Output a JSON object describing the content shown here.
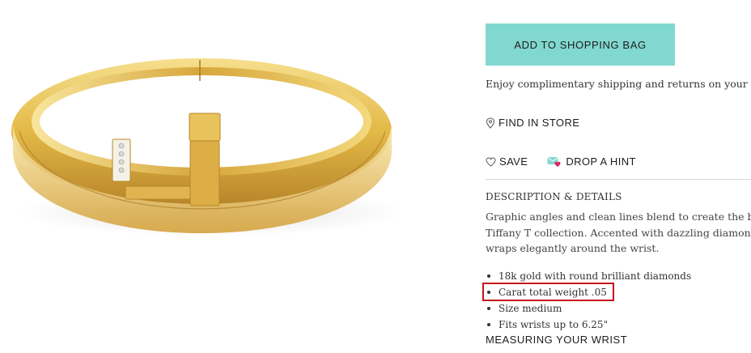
{
  "product": {
    "image_name": "tiffany-t-square-bracelet"
  },
  "purchase": {
    "add_to_bag_label": "ADD TO SHOPPING BAG",
    "shipping_text": "Enjoy complimentary shipping and returns on your orde",
    "accent_color": "#81d8d0"
  },
  "actions": {
    "find_in_store": "FIND IN STORE",
    "save": "SAVE",
    "drop_hint": "DROP A HINT"
  },
  "description": {
    "heading": "DESCRIPTION & DETAILS",
    "lines": [
      "Graphic angles and clean lines blend to create the beaut",
      "Tiffany T collection. Accented with dazzling diamonds,",
      "wraps elegantly around the wrist."
    ],
    "bullets": [
      "18k gold with round brilliant diamonds",
      "Carat total weight .05",
      "Size medium",
      "Fits wrists up to 6.25\""
    ],
    "highlighted_bullet_index": 1,
    "highlight_color": "#c8141c"
  },
  "measuring_link": "MEASURING YOUR WRIST"
}
